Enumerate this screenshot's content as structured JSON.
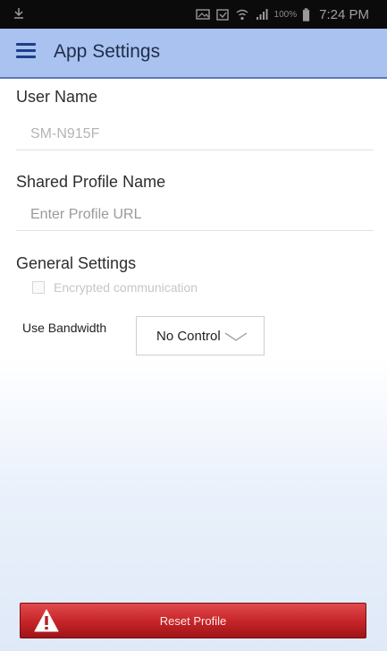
{
  "status_bar": {
    "battery_percent": "100%",
    "time": "7:24 PM",
    "icons": [
      "notification-icon",
      "image-icon",
      "calendar-icon",
      "wifi-icon",
      "signal-icon",
      "battery-icon"
    ]
  },
  "app_bar": {
    "title": "App Settings",
    "menu_icon": "hamburger-menu-icon",
    "color": "#a9c2ef"
  },
  "user_name": {
    "label": "User Name",
    "value": "SM-N915F"
  },
  "shared_profile": {
    "label": "Shared Profile Name",
    "placeholder": "Enter Profile URL"
  },
  "general_settings": {
    "label": "General Settings",
    "encrypted_label": "Encrypted communication",
    "encrypted_checked": false
  },
  "bandwidth": {
    "label": "Use Bandwidth",
    "selected": "No Control"
  },
  "reset": {
    "label": "Reset Profile",
    "icon": "warning-icon",
    "color": "#c8272a"
  }
}
